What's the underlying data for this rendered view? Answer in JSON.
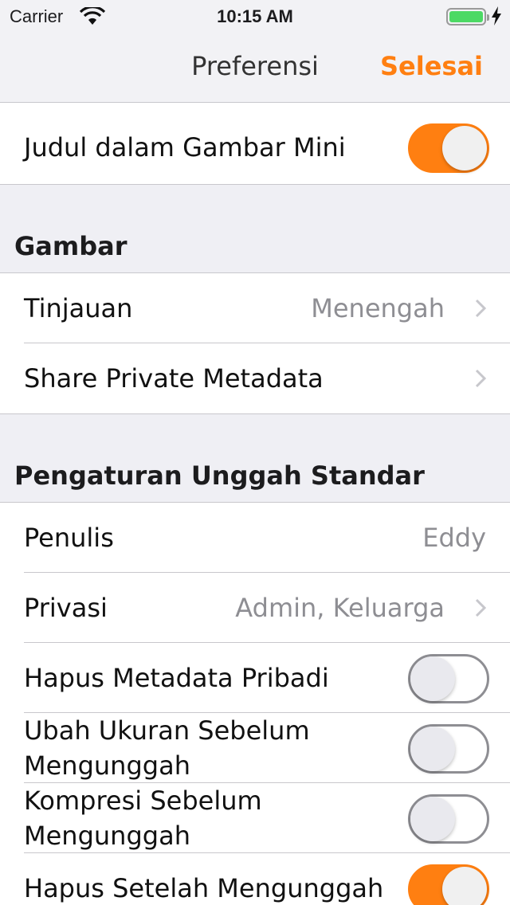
{
  "status_bar": {
    "carrier": "Carrier",
    "time": "10:15 AM",
    "battery_color": "#4cd964"
  },
  "nav": {
    "title": "Preferensi",
    "done_label": "Selesai",
    "accent_color": "#ff7f11"
  },
  "top_group": {
    "rows": [
      {
        "label": "Judul dalam Gambar Mini",
        "toggle": true
      }
    ]
  },
  "gambar": {
    "header": "Gambar",
    "rows": [
      {
        "label": "Tinjauan",
        "value": "Menengah",
        "icon": "chevron-right-icon"
      },
      {
        "label": "Share Private Metadata",
        "icon": "chevron-right-icon"
      }
    ]
  },
  "upload": {
    "header": "Pengaturan Unggah Standar",
    "rows": [
      {
        "label": "Penulis",
        "value": "Eddy"
      },
      {
        "label": "Privasi",
        "value": "Admin, Keluarga",
        "icon": "chevron-right-icon"
      },
      {
        "label": "Hapus Metadata Pribadi",
        "toggle": false
      },
      {
        "label": "Ubah Ukuran Sebelum Mengunggah",
        "toggle": false
      },
      {
        "label": "Kompresi Sebelum Mengunggah",
        "toggle": false
      },
      {
        "label": "Hapus Setelah Mengunggah",
        "toggle": true
      }
    ]
  }
}
